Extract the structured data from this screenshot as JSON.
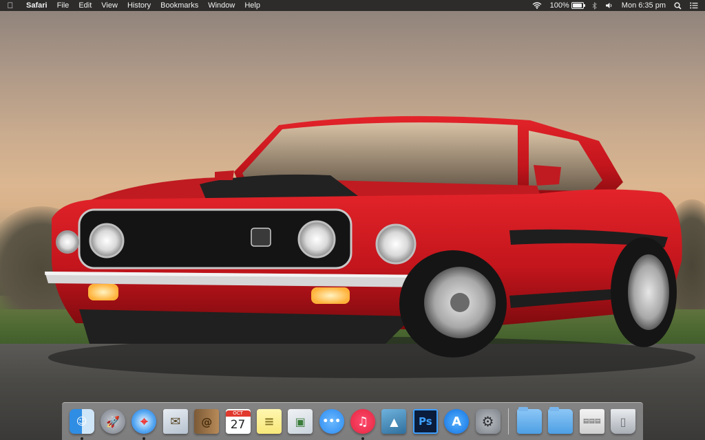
{
  "menubar": {
    "apple_icon": "apple-icon",
    "app_name": "Safari",
    "menus": [
      "File",
      "Edit",
      "View",
      "History",
      "Bookmarks",
      "Window",
      "Help"
    ],
    "status": {
      "wifi_icon": "wifi-icon",
      "battery_percent": "100%",
      "battery_icon_text": "⚡",
      "bluetooth_icon": "bluetooth-icon",
      "volume_icon": "volume-icon",
      "clock": "Mon 6:35 pm",
      "spotlight_icon": "search-icon",
      "notifications_icon": "list-icon"
    }
  },
  "dock": {
    "apps": [
      {
        "name": "Finder",
        "icon": "finder-icon",
        "glyph": "☺",
        "running": true
      },
      {
        "name": "Launchpad",
        "icon": "launchpad-icon",
        "glyph": "🚀",
        "running": false
      },
      {
        "name": "Safari",
        "icon": "safari-icon",
        "glyph": "⌖",
        "running": true
      },
      {
        "name": "Mail",
        "icon": "mail-icon",
        "glyph": "✉",
        "running": false
      },
      {
        "name": "Contacts",
        "icon": "contacts-icon",
        "glyph": "@",
        "running": false
      },
      {
        "name": "Calendar",
        "icon": "calendar-icon",
        "month": "OCT",
        "day": "27",
        "running": false
      },
      {
        "name": "Notes",
        "icon": "notes-icon",
        "glyph": "≡",
        "running": false
      },
      {
        "name": "Preview",
        "icon": "preview-icon",
        "glyph": "▣",
        "running": false
      },
      {
        "name": "Messages",
        "icon": "messages-icon",
        "glyph": "•••",
        "running": false
      },
      {
        "name": "iTunes",
        "icon": "itunes-icon",
        "glyph": "♫",
        "running": true
      },
      {
        "name": "iPhoto",
        "icon": "iphoto-icon",
        "glyph": "▲",
        "running": false
      },
      {
        "name": "Photoshop",
        "icon": "photoshop-icon",
        "label": "Ps",
        "running": false
      },
      {
        "name": "App Store",
        "icon": "appstore-icon",
        "glyph": "A",
        "running": false
      },
      {
        "name": "System Preferences",
        "icon": "sysprefs-icon",
        "glyph": "⚙",
        "running": false
      }
    ],
    "stacks": [
      {
        "name": "Applications folder",
        "icon": "folder-icon"
      },
      {
        "name": "Documents folder",
        "icon": "folder-icon"
      },
      {
        "name": "Downloads stack",
        "icon": "downloads-icon",
        "glyph": "▤▤▤"
      },
      {
        "name": "Trash",
        "icon": "trash-icon",
        "glyph": "▯"
      }
    ]
  }
}
